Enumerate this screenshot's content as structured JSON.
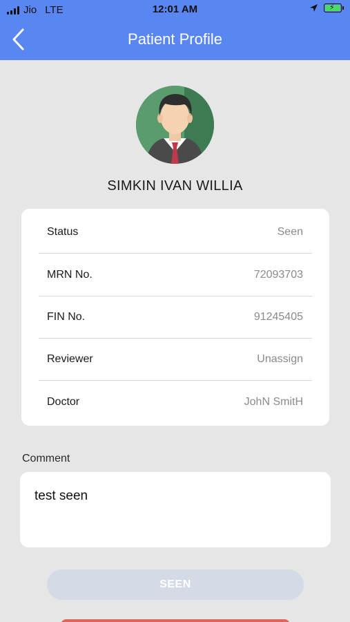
{
  "status_bar": {
    "carrier": "Jio",
    "network": "LTE",
    "time": "12:01 AM"
  },
  "header": {
    "title": "Patient Profile",
    "back_icon": "chevron-left-icon"
  },
  "patient": {
    "name": "SIMKIN IVAN WILLIA",
    "avatar_icon": "male-doctor-avatar"
  },
  "details": [
    {
      "label": "Status",
      "value": "Seen"
    },
    {
      "label": "MRN No.",
      "value": "72093703"
    },
    {
      "label": "FIN No.",
      "value": "91245405"
    },
    {
      "label": "Reviewer",
      "value": "Unassign"
    },
    {
      "label": "Doctor",
      "value": "JohN SmitH"
    }
  ],
  "comment": {
    "label": "Comment",
    "value": "test seen"
  },
  "actions": {
    "seen_label": "SEEN"
  },
  "colors": {
    "header_bg": "#5a86f2",
    "page_bg": "#e6e6e6",
    "seen_button_bg": "#d4dae6",
    "danger_button_bg": "#e0635c"
  }
}
